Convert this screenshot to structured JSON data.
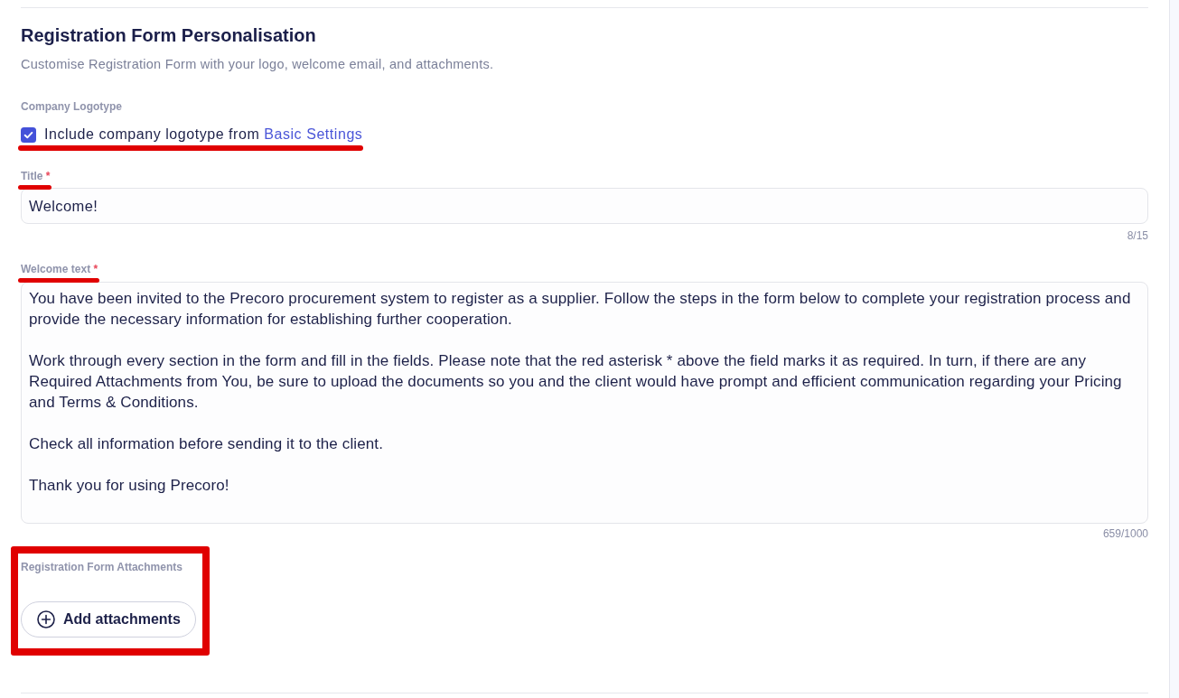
{
  "section": {
    "title": "Registration Form Personalisation",
    "description": "Customise Registration Form with your logo, welcome email, and attachments."
  },
  "logo": {
    "label": "Company Logotype",
    "checkbox": {
      "text": "Include company logotype from",
      "link": "Basic Settings",
      "checked": true,
      "annotated": true
    }
  },
  "fields": [
    {
      "kind": "input",
      "label": "Title",
      "required_mark": "*",
      "annotated": true,
      "value": "Welcome!",
      "counter": "8/15"
    },
    {
      "kind": "textarea",
      "label": "Welcome text",
      "required_mark": "*",
      "annotated": true,
      "value": "You have been invited to the Precoro procurement system to register as a supplier. Follow the steps in the form below to complete your registration process and provide the necessary information for establishing further cooperation.\n\nWork through every section in the form and fill in the fields. Please note that the red asterisk * above the field marks it as required. In turn, if there are any Required Attachments from You, be sure to upload the documents so you and the client would have prompt and efficient communication regarding your Pricing and Terms & Conditions.\n\nCheck all information before sending it to the client.\n\nThank you for using Precoro!",
      "counter": "659/1000"
    }
  ],
  "attachments": {
    "label": "Registration Form Attachments",
    "button": "Add attachments",
    "annotated": true
  }
}
